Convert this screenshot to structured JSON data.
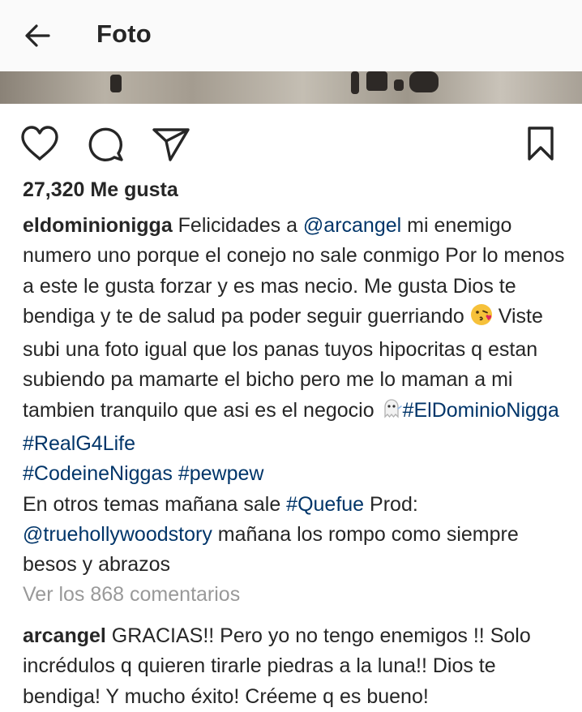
{
  "header": {
    "title": "Foto"
  },
  "icons": {
    "back": "arrow-left-icon",
    "like": "heart-outline-icon",
    "comment": "speech-bubble-icon",
    "share": "paper-plane-icon",
    "save": "bookmark-icon",
    "emoji_kiss": "face-blowing-kiss-emoji",
    "emoji_ghost": "ghost-emoji"
  },
  "post": {
    "likes": "27,320 Me gusta",
    "caption": {
      "author": "eldominionigga",
      "t1": " Felicidades a ",
      "mention1": "@arcangel",
      "t2": " mi enemigo numero uno porque el  conejo no sale conmigo Por lo menos a este le gusta forzar y es mas necio. Me gusta Dios te  bendiga y te de salud pa poder seguir guerriando ",
      "t3": " Viste subi una foto igual que los panas tuyos hipocritas q estan subiendo pa mamarte el bicho pero me lo maman a mi tambien tranquilo que asi es el negocio ",
      "hashtag1": "#ElDominioNigga",
      "hashtag2": "#RealG4Life",
      "hashtag3": "#CodeineNiggas",
      "hashtag4": "#pewpew",
      "t4": "En otros temas mañana sale ",
      "hashtag5": "#Quefue",
      "t5": " Prod: ",
      "mention2": "@truehollywoodstory",
      "t6": " mañana los rompo como siempre besos y abrazos"
    },
    "view_comments": "Ver los 868 comentarios",
    "comment": {
      "author": "arcangel",
      "text": " GRACIAS!! Pero yo no tengo enemigos !! Solo incrédulos q quieren tirarle piedras a la luna!! Dios te bendiga!  Y mucho éxito! Créeme q es bueno!"
    }
  },
  "colors": {
    "text": "#262626",
    "link": "#003569",
    "muted": "#999999",
    "header_bg": "#fafafa"
  }
}
